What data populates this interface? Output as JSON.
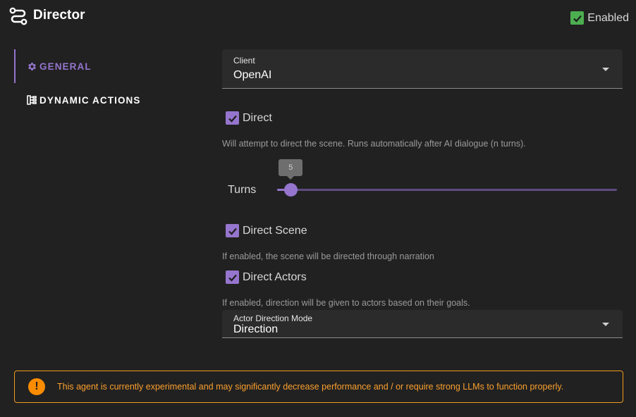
{
  "header": {
    "title": "Director",
    "logo_icon": "director-route-icon",
    "enabled_label": "Enabled",
    "enabled_checked": true
  },
  "colors": {
    "accent": "#9575cd",
    "enabled_green": "#4caf50",
    "warning": "#fb8c00",
    "background": "#212121"
  },
  "nav": {
    "items": [
      {
        "label": "GENERAL",
        "icon": "gear-icon",
        "active": true
      },
      {
        "label": "DYNAMIC ACTIONS",
        "icon": "tree-actions-icon",
        "active": false
      }
    ]
  },
  "form": {
    "client": {
      "label": "Client",
      "value": "OpenAI"
    },
    "direct": {
      "label": "Direct",
      "checked": true,
      "hint": "Will attempt to direct the scene. Runs automatically after AI dialogue (n turns)."
    },
    "turns": {
      "label": "Turns",
      "value": "5",
      "fraction": 0.04
    },
    "direct_scene": {
      "label": "Direct Scene",
      "checked": true,
      "hint": "If enabled, the scene will be directed through narration"
    },
    "direct_actors": {
      "label": "Direct Actors",
      "checked": true,
      "hint": "If enabled, direction will be given to actors based on their goals."
    },
    "actor_direction_mode": {
      "label": "Actor Direction Mode",
      "value": "Direction"
    }
  },
  "warning": {
    "icon": "exclamation-icon",
    "text": "This agent is currently experimental and may significantly decrease performance and / or require strong LLMs to function properly."
  }
}
